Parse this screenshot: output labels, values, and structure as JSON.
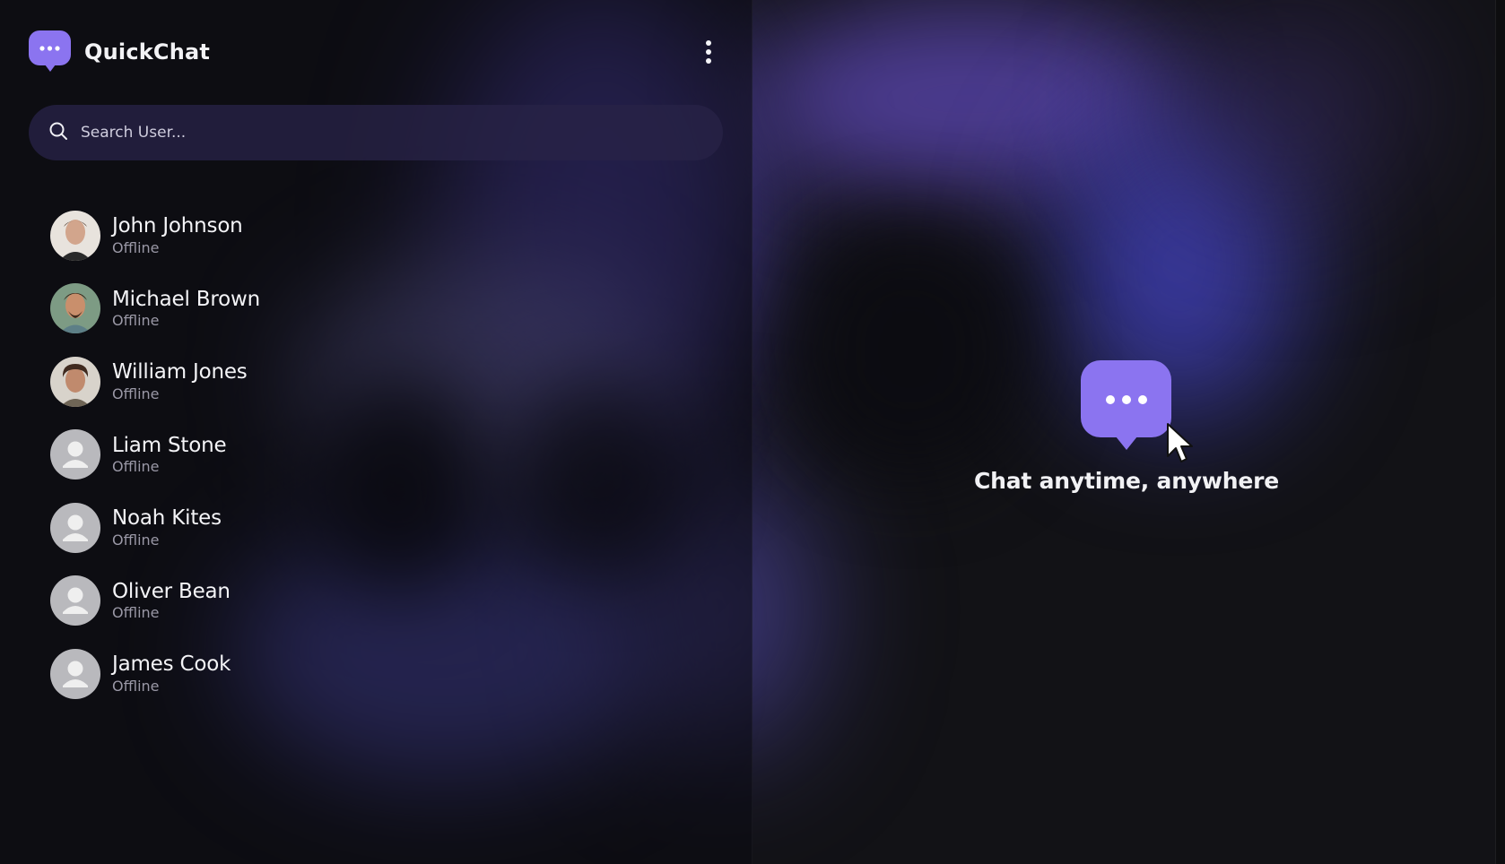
{
  "app": {
    "title": "QuickChat",
    "logo_icon": "chat-bubble-icon",
    "menu_icon": "more-vertical-icon",
    "accent_color": "#8b74f0",
    "background_color": "#121216"
  },
  "search": {
    "icon": "search-icon",
    "placeholder": "Search User...",
    "value": ""
  },
  "users": [
    {
      "name": "John Johnson",
      "status": "Offline",
      "avatar": "photo"
    },
    {
      "name": "Michael Brown",
      "status": "Offline",
      "avatar": "photo"
    },
    {
      "name": "William Jones",
      "status": "Offline",
      "avatar": "photo"
    },
    {
      "name": "Liam Stone",
      "status": "Offline",
      "avatar": "default-user-icon"
    },
    {
      "name": "Noah Kites",
      "status": "Offline",
      "avatar": "default-user-icon"
    },
    {
      "name": "Oliver Bean",
      "status": "Offline",
      "avatar": "default-user-icon"
    },
    {
      "name": "James Cook",
      "status": "Offline",
      "avatar": "default-user-icon"
    }
  ],
  "empty_state": {
    "icon": "chat-bubble-icon",
    "text": "Chat anytime, anywhere"
  }
}
